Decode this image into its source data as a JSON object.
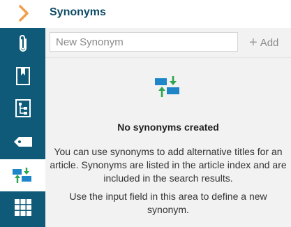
{
  "rail": {
    "items": [
      {
        "name": "attachments",
        "icon": "paperclip-icon"
      },
      {
        "name": "bookmarks",
        "icon": "bookmark-icon"
      },
      {
        "name": "structure",
        "icon": "tree-structure-icon"
      },
      {
        "name": "tags",
        "icon": "tag-icon"
      },
      {
        "name": "synonyms",
        "icon": "synonyms-icon",
        "active": true
      },
      {
        "name": "grid",
        "icon": "grid-icon"
      }
    ],
    "expand_icon": "chevron-right-icon"
  },
  "panel": {
    "title": "Synonyms",
    "input_placeholder": "New Synonym",
    "add_label": "Add",
    "empty_title": "No synonyms created",
    "empty_text_1": "You can use synonyms to add alternative titles for an article. Synonyms are listed in the article index and are included in the search results.",
    "empty_text_2": "Use the input field in this area to define a new synonym."
  },
  "colors": {
    "rail": "#0e5a78",
    "title": "#0e4a66",
    "accent_orange": "#f0a04a",
    "icon_blue": "#1e86c8",
    "icon_green": "#2ea44f"
  }
}
